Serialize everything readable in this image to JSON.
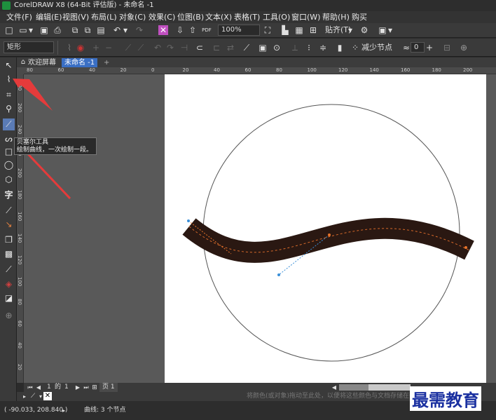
{
  "window": {
    "title": "CorelDRAW X8 (64-Bit 评估版) - 未命名 -1"
  },
  "menu": [
    "文件(F)",
    "编辑(E)",
    "视图(V)",
    "布局(L)",
    "对象(C)",
    "效果(C)",
    "位图(B)",
    "文本(X)",
    "表格(T)",
    "工具(O)",
    "窗口(W)",
    "帮助(H)",
    "购买"
  ],
  "toolbar": {
    "zoom": "100%",
    "snap": "贴齐(T)"
  },
  "property_bar": {
    "shape": "矩形",
    "reduce_nodes": "减少节点",
    "smooth_value": "0"
  },
  "tabs": [
    {
      "label": "欢迎屏幕"
    },
    {
      "label": "未命名 -1"
    }
  ],
  "ruler": {
    "h_ticks": [
      "80",
      "60",
      "40",
      "20",
      "0",
      "20",
      "40",
      "60",
      "80",
      "100",
      "120",
      "140",
      "160",
      "180",
      "200"
    ],
    "v_ticks": [
      "280",
      "260",
      "240",
      "220",
      "200",
      "180",
      "160",
      "140",
      "120",
      "100",
      "80",
      "60",
      "40",
      "20"
    ]
  },
  "tooltip": {
    "title": "贝塞尔工具",
    "body": "绘制曲线，一次绘制一段。"
  },
  "pagebar": {
    "current": "1",
    "of": "的",
    "total": "1",
    "page_tab": "页 1"
  },
  "palette_hint": "将颜色(或对象)拖动至此处，以便将这些颜色与文档存储在一起",
  "status": {
    "coords": "( -90.033, 208.840 )",
    "info": "曲线: 3 个节点"
  },
  "watermark": "最需教育"
}
